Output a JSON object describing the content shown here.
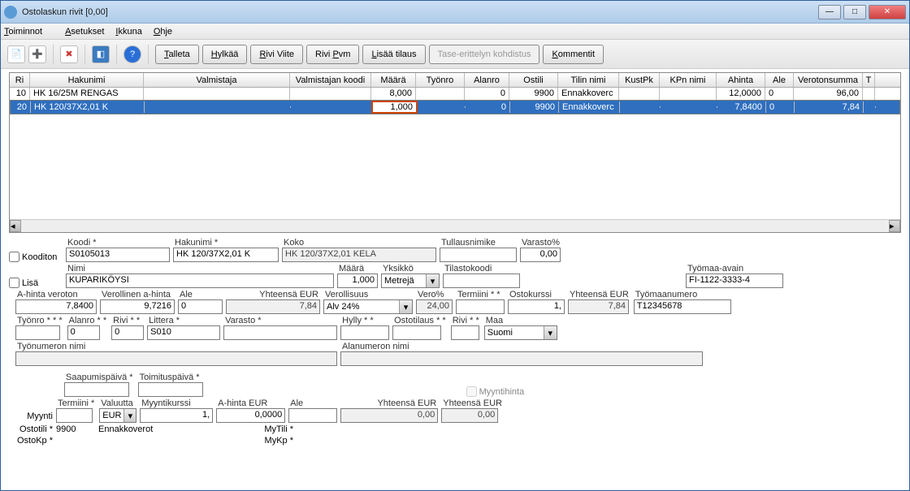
{
  "title": "Ostolaskun rivit [0,00]",
  "menu": {
    "toiminnot": "Toiminnot",
    "asetukset": "Asetukset",
    "ikkuna": "Ikkuna",
    "ohje": "Ohje"
  },
  "toolbar": {
    "talleta": "Talleta",
    "hylkaa": "Hylkää",
    "riviviite": "Rivi Viite",
    "rivipvm": "Rivi Pvm",
    "lisaatilaus": "Lisää tilaus",
    "tase": "Tase-erittelyn kohdistus",
    "kommentit": "Kommentit"
  },
  "grid": {
    "headers": {
      "ri": "Ri",
      "hakunimi": "Hakunimi",
      "valmistaja": "Valmistaja",
      "valmkoodi": "Valmistajan koodi",
      "maara": "Määrä",
      "tyonro": "Työnro",
      "alanro": "Alanro",
      "ostili": "Ostili",
      "tilinnimi": "Tilin nimi",
      "kustpk": "KustPk",
      "kpnnimi": "KPn nimi",
      "ahinta": "Ahinta",
      "ale": "Ale",
      "verotonsumma": "Verotonsumma",
      "t": "T"
    },
    "rows": [
      {
        "ri": "10",
        "hakunimi": "HK 16/25M RENGAS",
        "valmistaja": "",
        "valmkoodi": "",
        "maara": "8,000",
        "tyonro": "",
        "alanro": "0",
        "ostili": "9900",
        "tilinnimi": "Ennakkoverc",
        "kustpk": "",
        "kpnnimi": "",
        "ahinta": "12,0000",
        "ale": "0",
        "verotonsumma": "96,00"
      },
      {
        "ri": "20",
        "hakunimi": "HK 120/37X2,01 K",
        "valmistaja": "",
        "valmkoodi": "",
        "maara": "1,000",
        "tyonro": "",
        "alanro": "0",
        "ostili": "9900",
        "tilinnimi": "Ennakkoverc",
        "kustpk": "",
        "kpnnimi": "",
        "ahinta": "7,8400",
        "ale": "0",
        "verotonsumma": "7,84"
      }
    ]
  },
  "form": {
    "kooditon": "Kooditon",
    "lisa": "Lisä",
    "koodi_l": "Koodi *",
    "koodi": "S0105013",
    "hakunimi_l": "Hakunimi *",
    "hakunimi": "HK 120/37X2,01 K",
    "koko_l": "Koko",
    "koko": "HK 120/37X2,01 KELA",
    "tullausnimike_l": "Tullausnimike",
    "tullausnimike": "",
    "varastopct_l": "Varasto%",
    "varastopct": "0,00",
    "nimi_l": "Nimi",
    "nimi": "KUPARIKÖYSI",
    "maara_l": "Määrä",
    "maara": "1,000",
    "yksikko_l": "Yksikkö",
    "yksikko": "Metrejä",
    "tilastokoodi_l": "Tilastokoodi",
    "tilastokoodi": "",
    "tyomaaavain_l": "Työmaa-avain",
    "tyomaaavain": "FI-1122-3333-4",
    "ahveroton_l": "A-hinta veroton",
    "ahveroton": "7,8400",
    "verollah_l": "Verollinen a-hinta",
    "verollah": "9,7216",
    "ale_l": "Ale",
    "ale": "0",
    "yht_eur_l": "Yhteensä EUR",
    "yht_eur": "7,84",
    "verollisuus_l": "Verollisuus",
    "verollisuus": "Alv 24%",
    "veropct_l": "Vero%",
    "veropct": "24,00",
    "termiini_l": "Termiini * *",
    "termiini": "",
    "ostokurssi_l": "Ostokurssi",
    "ostokurssi": "1,",
    "yht_eur2": "7,84",
    "tyomaanro_l": "Työmaanumero",
    "tyomaanro": "T12345678",
    "tyonro_l": "Työnro * * *",
    "tyonro": "",
    "alanro_l": "Alanro * *",
    "alanro": "0",
    "rivi_l": "Rivi * *",
    "rivi": "0",
    "littera_l": "Littera *",
    "littera": "S010",
    "varasto_l": "Varasto *",
    "varasto": "",
    "hylly_l": "Hylly * *",
    "hylly": "",
    "ostotilaus_l": "Ostotilaus * *",
    "ostotilaus": "",
    "rivi2_l": "Rivi * *",
    "rivi2": "",
    "maa_l": "Maa",
    "maa": "Suomi",
    "tyonron_nimi_l": "Työnumeron nimi",
    "tyonron_nimi": "",
    "alanron_nimi_l": "Alanumeron nimi",
    "alanron_nimi": "",
    "saapumispv_l": "Saapumispäivä *",
    "saapumispv": "",
    "toimituspv_l": "Toimituspäivä *",
    "toimituspv": "",
    "myyntihinta_l": "Myyntihinta",
    "myynti_l": "Myynti",
    "termiini2_l": "Termiini *",
    "termiini2": "",
    "valuutta_l": "Valuutta",
    "valuutta": "EUR",
    "myyntikurssi_l": "Myyntikurssi",
    "myyntikurssi": "1,",
    "ahinta_eur_l": "A-hinta EUR",
    "ahinta_eur": "0,0000",
    "ale2_l": "Ale",
    "ale2": "",
    "yht_eur3_l": "Yhteensä EUR",
    "yht_eur3": "0,00",
    "yht_eur4_l": "Yhteensä EUR",
    "yht_eur4": "0,00",
    "ostotili_l": "Ostotili *",
    "ostotili": "9900",
    "ostotili_nimi": "Ennakkoverot",
    "mytili_l": "MyTili *",
    "mytili": "",
    "ostokp_l": "OstoKp *",
    "ostokp": "",
    "mykp_l": "MyKp *",
    "mykp": ""
  }
}
